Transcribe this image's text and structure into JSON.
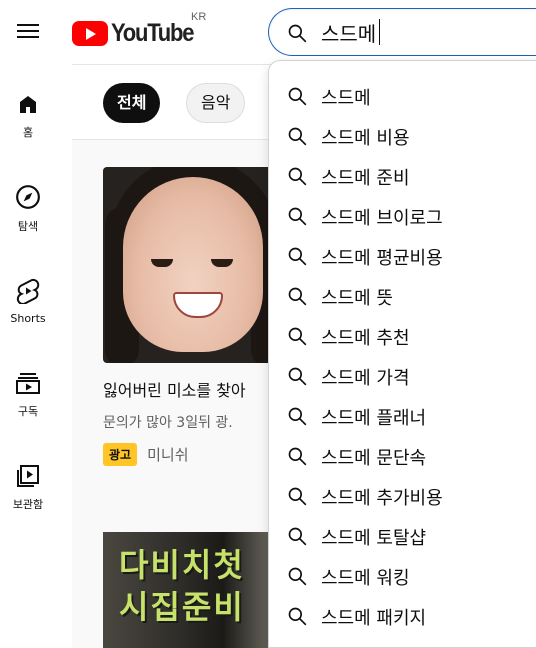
{
  "header": {
    "logo_text": "YouTube",
    "country_code": "KR",
    "search_value": "스드메"
  },
  "guide": {
    "items": [
      {
        "label": "홈",
        "icon": "home-icon"
      },
      {
        "label": "탐색",
        "icon": "compass-icon"
      },
      {
        "label": "Shorts",
        "icon": "shorts-icon"
      },
      {
        "label": "구독",
        "icon": "subscriptions-icon"
      },
      {
        "label": "보관함",
        "icon": "library-icon"
      }
    ]
  },
  "chips": [
    {
      "label": "전체",
      "selected": true
    },
    {
      "label": "음악",
      "selected": false
    }
  ],
  "videos": [
    {
      "title": "잃어버린 미소를 찾아",
      "description": "문의가 많아 3일뒤 광.",
      "ad_label": "광고",
      "channel": "미니쉬"
    },
    {
      "thumb_text_line1": "다비치첫",
      "thumb_text_line2": "시집준비"
    }
  ],
  "suggestions": [
    "스드메",
    "스드메 비용",
    "스드메 준비",
    "스드메 브이로그",
    "스드메 평균비용",
    "스드메 뜻",
    "스드메 추천",
    "스드메 가격",
    "스드메 플래너",
    "스드메 문단속",
    "스드메 추가비용",
    "스드메 토탈샵",
    "스드메 워킹",
    "스드메 패키지"
  ],
  "colors": {
    "brand_red": "#ff0000",
    "search_focus_border": "#1c62b9",
    "ad_badge": "#ffc425",
    "chip_active_bg": "#0f0f0f"
  }
}
